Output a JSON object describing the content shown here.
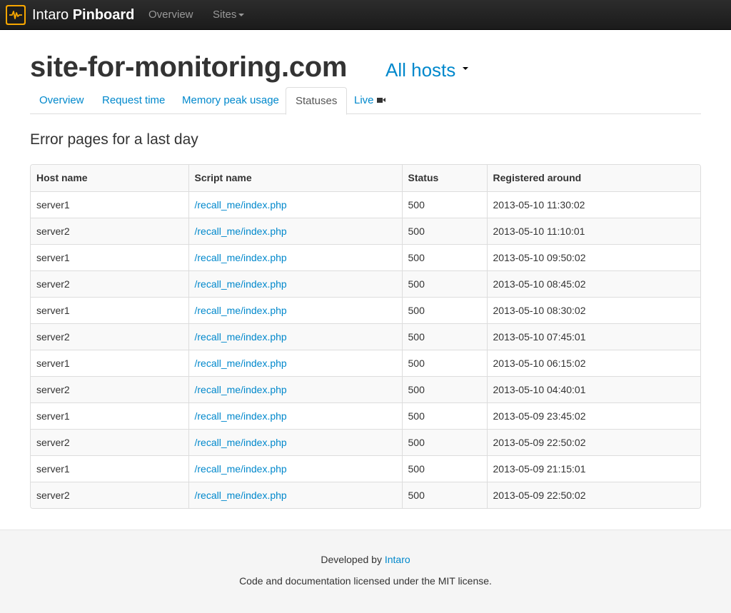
{
  "navbar": {
    "brand_light": "Intaro",
    "brand_bold": "Pinboard",
    "logo_icon": "pulse-icon",
    "links": {
      "overview": "Overview",
      "sites": "Sites"
    }
  },
  "header": {
    "title": "site-for-monitoring.com",
    "hosts_dropdown": "All hosts"
  },
  "tabs": [
    {
      "label": "Overview"
    },
    {
      "label": "Request time"
    },
    {
      "label": "Memory peak usage"
    },
    {
      "label": "Statuses",
      "active": true
    },
    {
      "label": "Live",
      "icon": "video-camera-icon"
    }
  ],
  "section": {
    "title": "Error pages for a last day"
  },
  "table": {
    "headers": [
      "Host name",
      "Script name",
      "Status",
      "Registered around"
    ],
    "rows": [
      {
        "host": "server1",
        "script": "/recall_me/index.php",
        "status": "500",
        "time": "2013-05-10 11:30:02"
      },
      {
        "host": "server2",
        "script": "/recall_me/index.php",
        "status": "500",
        "time": "2013-05-10 11:10:01"
      },
      {
        "host": "server1",
        "script": "/recall_me/index.php",
        "status": "500",
        "time": "2013-05-10 09:50:02"
      },
      {
        "host": "server2",
        "script": "/recall_me/index.php",
        "status": "500",
        "time": "2013-05-10 08:45:02"
      },
      {
        "host": "server1",
        "script": "/recall_me/index.php",
        "status": "500",
        "time": "2013-05-10 08:30:02"
      },
      {
        "host": "server2",
        "script": "/recall_me/index.php",
        "status": "500",
        "time": "2013-05-10 07:45:01"
      },
      {
        "host": "server1",
        "script": "/recall_me/index.php",
        "status": "500",
        "time": "2013-05-10 06:15:02"
      },
      {
        "host": "server2",
        "script": "/recall_me/index.php",
        "status": "500",
        "time": "2013-05-10 04:40:01"
      },
      {
        "host": "server1",
        "script": "/recall_me/index.php",
        "status": "500",
        "time": "2013-05-09 23:45:02"
      },
      {
        "host": "server2",
        "script": "/recall_me/index.php",
        "status": "500",
        "time": "2013-05-09 22:50:02"
      },
      {
        "host": "server1",
        "script": "/recall_me/index.php",
        "status": "500",
        "time": "2013-05-09 21:15:01"
      },
      {
        "host": "server2",
        "script": "/recall_me/index.php",
        "status": "500",
        "time": "2013-05-09 22:50:02"
      }
    ]
  },
  "footer": {
    "developed_prefix": "Developed by ",
    "developer_link": "Intaro",
    "license": "Code and documentation licensed under the MIT license."
  }
}
